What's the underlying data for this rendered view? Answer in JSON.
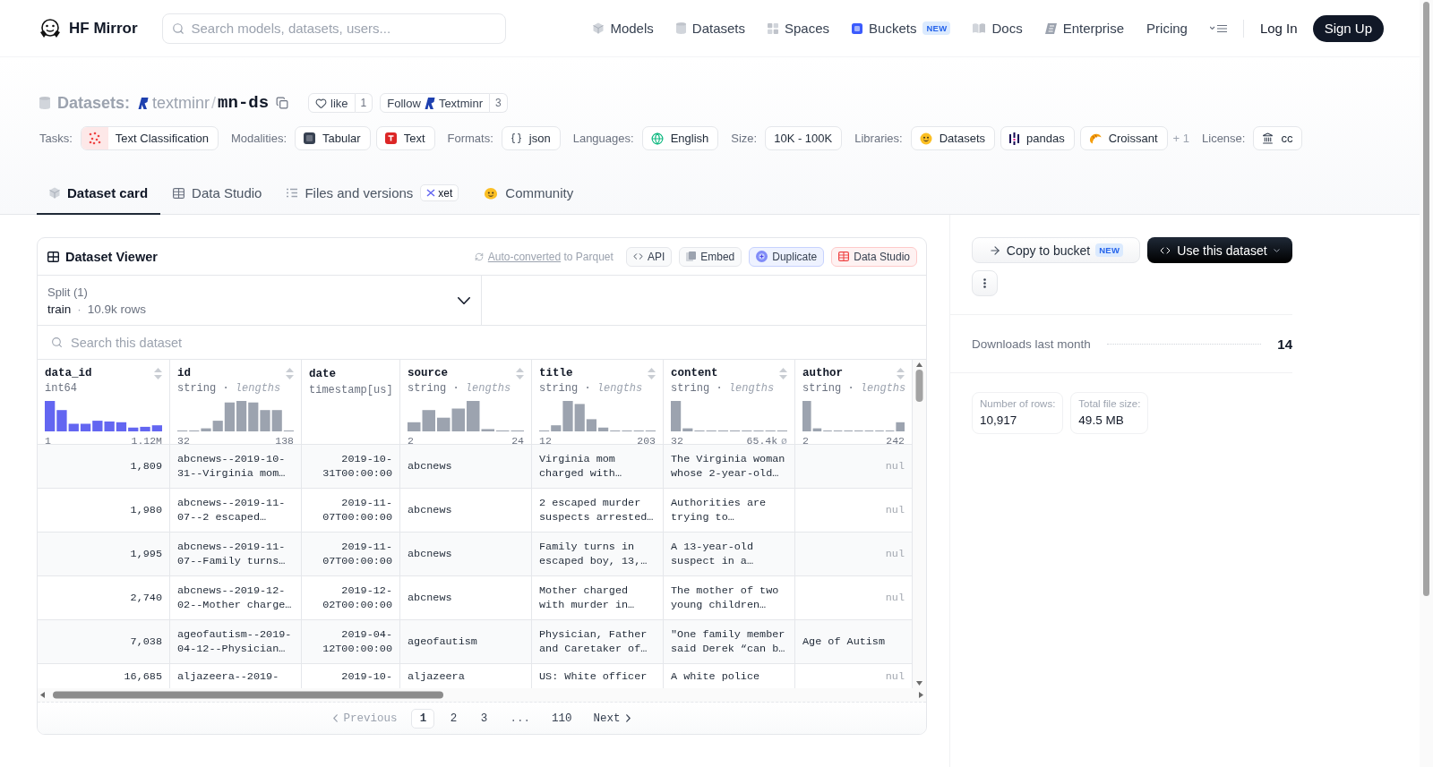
{
  "header": {
    "brand": "HF Mirror",
    "search": {
      "placeholder": "Search models, datasets, users..."
    },
    "nav": [
      {
        "kind": "models",
        "label": "Models"
      },
      {
        "kind": "datasets",
        "label": "Datasets"
      },
      {
        "kind": "spaces",
        "label": "Spaces"
      },
      {
        "kind": "buckets",
        "label": "Buckets",
        "badge": "NEW"
      },
      {
        "kind": "docs",
        "label": "Docs"
      },
      {
        "kind": "enterprise",
        "label": "Enterprise"
      },
      {
        "kind": "pricing",
        "label": "Pricing"
      }
    ],
    "login": "Log In",
    "signup": "Sign Up"
  },
  "repo": {
    "type": "Datasets:",
    "owner": "textminr",
    "separator": "/",
    "name": "mn-ds",
    "like": {
      "label": "like",
      "count": "1"
    },
    "follow": {
      "label": "Follow",
      "org": "Textminr",
      "count": "3"
    }
  },
  "tags": [
    {
      "label": "Tasks:",
      "chips": [
        {
          "kind": "task",
          "label": "Text Classification"
        }
      ]
    },
    {
      "label": "Modalities:",
      "chips": [
        {
          "kind": "tabular",
          "label": "Tabular"
        },
        {
          "kind": "text",
          "label": "Text"
        }
      ]
    },
    {
      "label": "Formats:",
      "chips": [
        {
          "kind": "json",
          "label": "json"
        }
      ]
    },
    {
      "label": "Languages:",
      "chips": [
        {
          "kind": "language",
          "label": "English"
        }
      ]
    },
    {
      "label": "Size:",
      "chips": [
        {
          "kind": "plain",
          "label": "10K - 100K"
        }
      ]
    },
    {
      "label": "Libraries:",
      "chips": [
        {
          "kind": "datasets",
          "label": "Datasets"
        },
        {
          "kind": "pandas",
          "label": "pandas"
        },
        {
          "kind": "croissant",
          "label": "Croissant"
        }
      ],
      "more": "+ 1"
    },
    {
      "label": "License:",
      "chips": [
        {
          "kind": "license",
          "label": "cc"
        }
      ]
    }
  ],
  "tabs": [
    {
      "kind": "card",
      "label": "Dataset card",
      "selected": true
    },
    {
      "kind": "studio",
      "label": "Data Studio",
      "selected": false
    },
    {
      "kind": "files",
      "label": "Files and versions",
      "badge": "xet",
      "selected": false
    },
    {
      "kind": "community",
      "label": "Community",
      "selected": false
    }
  ],
  "viewer": {
    "title": "Dataset Viewer",
    "conversion": {
      "link": "Auto-converted",
      "text": "to Parquet"
    },
    "actions": [
      {
        "kind": "api",
        "label": "API"
      },
      {
        "kind": "embed",
        "label": "Embed"
      },
      {
        "kind": "duplicate",
        "label": "Duplicate"
      },
      {
        "kind": "studio",
        "label": "Data Studio"
      }
    ],
    "split": {
      "label": "Split (1)",
      "value": "train",
      "separator": "·",
      "rows": "10.9k rows"
    },
    "search": {
      "placeholder": "Search this dataset"
    },
    "columns": [
      {
        "name": "data_id",
        "kind": "numeric",
        "dtype": "int64",
        "min": "1",
        "max": "1.12M",
        "sortable": true
      },
      {
        "name": "id",
        "kind": "string",
        "dtype": "string",
        "separator": "·",
        "note": "lengths",
        "min": "32",
        "max": "138",
        "sortable": true
      },
      {
        "name": "date",
        "kind": "timestamp",
        "dtype": "timestamp[us]",
        "sortable": false
      },
      {
        "name": "source",
        "kind": "string",
        "dtype": "string",
        "separator": "·",
        "note": "lengths",
        "min": "2",
        "max": "24",
        "sortable": true
      },
      {
        "name": "title",
        "kind": "string",
        "dtype": "string",
        "separator": "·",
        "note": "lengths",
        "min": "12",
        "max": "203",
        "sortable": true
      },
      {
        "name": "content",
        "kind": "string",
        "dtype": "string",
        "separator": "·",
        "note": "lengths",
        "min": "32",
        "max": "65.4k",
        "null_mark": "ø",
        "sortable": true
      },
      {
        "name": "author",
        "kind": "string",
        "dtype": "string",
        "separator": "·",
        "note": "lengths",
        "min": "2",
        "max": "242",
        "sortable": true
      }
    ],
    "rows": [
      {
        "cells": [
          {
            "text": "1,809",
            "null": false
          },
          {
            "text": "abcnews--2019-10-31--Virginia mom…",
            "null": false
          },
          {
            "text": "2019-10-31T00:00:00",
            "null": false
          },
          {
            "text": "abcnews",
            "null": false
          },
          {
            "text": "Virginia mom charged with…",
            "null": false
          },
          {
            "text": "The Virginia woman whose 2-year-old…",
            "null": false
          },
          {
            "text": "nul",
            "null": true
          }
        ]
      },
      {
        "cells": [
          {
            "text": "1,980",
            "null": false
          },
          {
            "text": "abcnews--2019-11-07--2 escaped…",
            "null": false
          },
          {
            "text": "2019-11-07T00:00:00",
            "null": false
          },
          {
            "text": "abcnews",
            "null": false
          },
          {
            "text": "2 escaped murder suspects arrested…",
            "null": false
          },
          {
            "text": "Authorities are trying to…",
            "null": false
          },
          {
            "text": "nul",
            "null": true
          }
        ]
      },
      {
        "cells": [
          {
            "text": "1,995",
            "null": false
          },
          {
            "text": "abcnews--2019-11-07--Family turns…",
            "null": false
          },
          {
            "text": "2019-11-07T00:00:00",
            "null": false
          },
          {
            "text": "abcnews",
            "null": false
          },
          {
            "text": "Family turns in escaped boy, 13,…",
            "null": false
          },
          {
            "text": "A 13-year-old suspect in a…",
            "null": false
          },
          {
            "text": "nul",
            "null": true
          }
        ]
      },
      {
        "cells": [
          {
            "text": "2,740",
            "null": false
          },
          {
            "text": "abcnews--2019-12-02--Mother charge…",
            "null": false
          },
          {
            "text": "2019-12-02T00:00:00",
            "null": false
          },
          {
            "text": "abcnews",
            "null": false
          },
          {
            "text": "Mother charged with murder in…",
            "null": false
          },
          {
            "text": "The mother of two young children…",
            "null": false
          },
          {
            "text": "nul",
            "null": true
          }
        ]
      },
      {
        "cells": [
          {
            "text": "7,038",
            "null": false
          },
          {
            "text": "ageofautism--2019-04-12--Physician…",
            "null": false
          },
          {
            "text": "2019-04-12T00:00:00",
            "null": false
          },
          {
            "text": "ageofautism",
            "null": false
          },
          {
            "text": "Physician, Father and Caretaker of…",
            "null": false
          },
          {
            "text": "\"One family member said Derek “can b…",
            "null": false
          },
          {
            "text": "Age of Autism",
            "null": false
          }
        ]
      },
      {
        "cells": [
          {
            "text": "16,685",
            "null": false
          },
          {
            "text": "aljazeera--2019-",
            "null": false
          },
          {
            "text": "2019-10-",
            "null": false
          },
          {
            "text": "aljazeera",
            "null": false
          },
          {
            "text": "US: White officer",
            "null": false
          },
          {
            "text": "A white police",
            "null": false
          },
          {
            "text": "nul",
            "null": true
          }
        ]
      }
    ],
    "pagination": {
      "previous": {
        "label": "Previous",
        "disabled": true
      },
      "pages": [
        {
          "kind": "page",
          "label": "1",
          "selected": true
        },
        {
          "kind": "page",
          "label": "2",
          "selected": false
        },
        {
          "kind": "page",
          "label": "3",
          "selected": false
        },
        {
          "kind": "gap",
          "label": "...",
          "selected": false
        },
        {
          "kind": "page",
          "label": "110",
          "selected": false
        }
      ],
      "next": {
        "label": "Next",
        "disabled": false
      }
    }
  },
  "sidebar": {
    "copy": {
      "label": "Copy to bucket",
      "badge": "NEW"
    },
    "use": {
      "label": "Use this dataset"
    },
    "downloads": {
      "label": "Downloads last month",
      "value": "14"
    },
    "stats": [
      {
        "label": "Number of rows:",
        "value": "10,917"
      },
      {
        "label": "Total file size:",
        "value": "49.5 MB"
      }
    ]
  }
}
